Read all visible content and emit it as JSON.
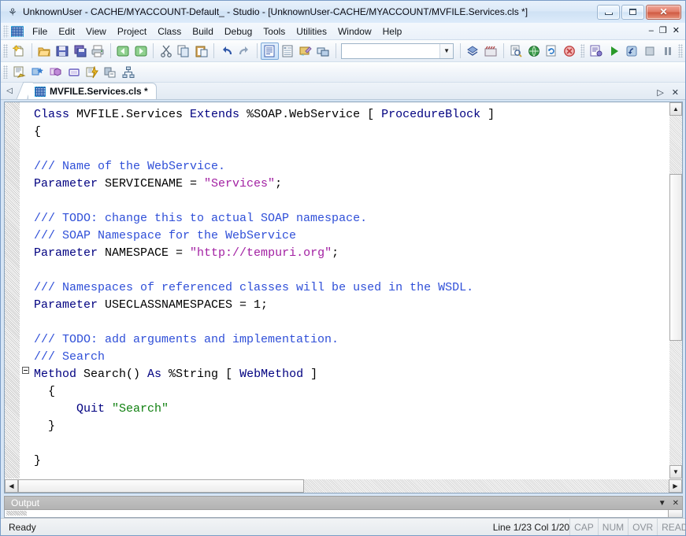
{
  "window": {
    "title": "UnknownUser - CACHE/MYACCOUNT-Default_ - Studio - [UnknownUser-CACHE/MYACCOUNT/MVFILE.Services.cls *]",
    "app_icon": "studio-icon",
    "minimize_label": "Minimize",
    "restore_label": "Restore",
    "close_label": "Close"
  },
  "menubar": {
    "items": [
      {
        "label": "File"
      },
      {
        "label": "Edit"
      },
      {
        "label": "View"
      },
      {
        "label": "Project"
      },
      {
        "label": "Class"
      },
      {
        "label": "Build"
      },
      {
        "label": "Debug"
      },
      {
        "label": "Tools"
      },
      {
        "label": "Utilities"
      },
      {
        "label": "Window"
      },
      {
        "label": "Help"
      }
    ],
    "mdi": {
      "minimize": "–",
      "restore": "❐",
      "close": "✕"
    }
  },
  "toolbar_main": {
    "buttons": [
      {
        "name": "new-file-button",
        "glyph": "✦",
        "color": "#e8a317"
      },
      {
        "name": "open-file-button",
        "glyph": "▱",
        "color": "#e0a030"
      },
      {
        "name": "save-button",
        "glyph": "▣",
        "color": "#4a5fb0"
      },
      {
        "name": "save-all-button",
        "glyph": "▤",
        "color": "#6a5fb0"
      },
      {
        "name": "print-button",
        "glyph": "⎙",
        "color": "#7a8a99"
      },
      {
        "name": "back-button",
        "glyph": "←",
        "color": "#5aa05a"
      },
      {
        "name": "forward-button",
        "glyph": "→",
        "color": "#5aa05a"
      },
      {
        "name": "cut-button",
        "glyph": "✂",
        "color": "#5a6a7a"
      },
      {
        "name": "copy-button",
        "glyph": "⧉",
        "color": "#7a8fa8"
      },
      {
        "name": "paste-button",
        "glyph": "ὌB",
        "color": "#c8a060"
      },
      {
        "name": "undo-button",
        "glyph": "↶",
        "color": "#3a5fb0"
      },
      {
        "name": "redo-button",
        "glyph": "↷",
        "color": "#7a8fa8"
      },
      {
        "name": "view-source-button",
        "glyph": "▤",
        "color": "#3a5fb0",
        "selected": true
      },
      {
        "name": "view-inspector-button",
        "glyph": "☷",
        "color": "#6a7a8a"
      },
      {
        "name": "view-palette-button",
        "glyph": "▧",
        "color": "#c89030"
      },
      {
        "name": "view-layout-button",
        "glyph": "▦",
        "color": "#5a7fb0"
      }
    ],
    "combo": {
      "value": "",
      "placeholder": ""
    },
    "buttons_right": [
      {
        "name": "compile-button",
        "glyph": "◆",
        "color": "#4a6fa5"
      },
      {
        "name": "compile-all-button",
        "glyph": "▥",
        "color": "#a05a5a"
      },
      {
        "name": "find-in-files-button",
        "glyph": "ὐE",
        "color": "#7a8a99"
      },
      {
        "name": "view-web-page-button",
        "glyph": "●",
        "color": "#3a8a3a"
      },
      {
        "name": "refresh-button",
        "glyph": "⟳",
        "color": "#4a7fb0"
      },
      {
        "name": "stop-button",
        "glyph": "✕",
        "color": "#c04040"
      },
      {
        "name": "debug-target-button",
        "glyph": "▤",
        "color": "#6a5fb0"
      },
      {
        "name": "run-button",
        "glyph": "▶",
        "color": "#2a9a2a"
      },
      {
        "name": "step-into-button",
        "glyph": "↰",
        "color": "#5a7fb0"
      },
      {
        "name": "stop-debug-button",
        "glyph": "■",
        "color": "#8090a0"
      },
      {
        "name": "pause-button",
        "glyph": "⏸",
        "color": "#6a7a8a"
      }
    ]
  },
  "toolbar_second": {
    "buttons": [
      {
        "name": "class-wizard-button",
        "glyph": "▤",
        "color": "#c8a030"
      },
      {
        "name": "new-property-button",
        "glyph": "❖",
        "color": "#3a7fd0"
      },
      {
        "name": "new-method-button",
        "glyph": "⬟",
        "color": "#a060c0"
      },
      {
        "name": "new-parameter-button",
        "glyph": "▭",
        "color": "#7a6fc0"
      },
      {
        "name": "new-query-button",
        "glyph": "⚡",
        "color": "#d0a030"
      },
      {
        "name": "new-index-button",
        "glyph": "▨",
        "color": "#8a9aaa"
      },
      {
        "name": "class-hierarchy-button",
        "glyph": "⛓",
        "color": "#5a7a9a"
      }
    ]
  },
  "tabstrip": {
    "nav_left_icon": "triangle-left-icon",
    "tabs": [
      {
        "label": "MVFILE.Services.cls *",
        "icon": "class-file-icon",
        "active": true
      }
    ],
    "nav_right_icon": "triangle-right-icon",
    "close_icon": "✕"
  },
  "editor": {
    "lines": [
      [
        {
          "t": "Class ",
          "c": "kw"
        },
        {
          "t": "MVFILE.Services",
          "c": "id"
        },
        {
          "t": " Extends ",
          "c": "kw"
        },
        {
          "t": "%SOAP.WebService",
          "c": "id"
        },
        {
          "t": " [ ",
          "c": "pln"
        },
        {
          "t": "ProcedureBlock",
          "c": "kw"
        },
        {
          "t": " ]",
          "c": "pln"
        }
      ],
      [
        {
          "t": "{",
          "c": "pln"
        }
      ],
      [
        {
          "t": "",
          "c": "pln"
        }
      ],
      [
        {
          "t": "/// Name of the WebService.",
          "c": "cmt"
        }
      ],
      [
        {
          "t": "Parameter ",
          "c": "kw"
        },
        {
          "t": "SERVICENAME = ",
          "c": "id"
        },
        {
          "t": "\"Services\"",
          "c": "str"
        },
        {
          "t": ";",
          "c": "pln"
        }
      ],
      [
        {
          "t": "",
          "c": "pln"
        }
      ],
      [
        {
          "t": "/// TODO: change this to actual SOAP namespace.",
          "c": "cmt"
        }
      ],
      [
        {
          "t": "/// SOAP Namespace for the WebService",
          "c": "cmt"
        }
      ],
      [
        {
          "t": "Parameter ",
          "c": "kw"
        },
        {
          "t": "NAMESPACE = ",
          "c": "id"
        },
        {
          "t": "\"http://tempuri.org\"",
          "c": "str"
        },
        {
          "t": ";",
          "c": "pln"
        }
      ],
      [
        {
          "t": "",
          "c": "pln"
        }
      ],
      [
        {
          "t": "/// Namespaces of referenced classes will be used in the WSDL.",
          "c": "cmt"
        }
      ],
      [
        {
          "t": "Parameter ",
          "c": "kw"
        },
        {
          "t": "USECLASSNAMESPACES = 1;",
          "c": "id"
        }
      ],
      [
        {
          "t": "",
          "c": "pln"
        }
      ],
      [
        {
          "t": "/// TODO: add arguments and implementation.",
          "c": "cmt"
        }
      ],
      [
        {
          "t": "/// Search",
          "c": "cmt"
        }
      ],
      [
        {
          "t": "Method ",
          "c": "kw"
        },
        {
          "t": "Search() ",
          "c": "id"
        },
        {
          "t": "As ",
          "c": "kw"
        },
        {
          "t": "%String",
          "c": "id"
        },
        {
          "t": " [ ",
          "c": "pln"
        },
        {
          "t": "WebMethod",
          "c": "kw"
        },
        {
          "t": " ]",
          "c": "pln"
        }
      ],
      [
        {
          "t": "  {",
          "c": "pln"
        }
      ],
      [
        {
          "t": "      ",
          "c": "pln"
        },
        {
          "t": "Quit ",
          "c": "kw"
        },
        {
          "t": "\"Search\"",
          "c": "strg"
        }
      ],
      [
        {
          "t": "  }",
          "c": "pln"
        }
      ],
      [
        {
          "t": "",
          "c": "pln"
        }
      ],
      [
        {
          "t": "}",
          "c": "pln"
        }
      ]
    ],
    "fold_marker_line": 16,
    "vscroll": {
      "up_icon": "▲",
      "down_icon": "▼"
    },
    "hscroll": {
      "left_icon": "◀",
      "right_icon": "▶"
    }
  },
  "output_pane": {
    "title": "Output",
    "menu_icon": "▼",
    "close_icon": "✕"
  },
  "statusbar": {
    "status": "Ready",
    "position": "Line 1/23 Col 1/20",
    "flags": [
      "CAP",
      "NUM",
      "OVR",
      "READ"
    ]
  },
  "colors": {
    "titlebar_start": "#e8f1fb",
    "titlebar_end": "#dcebfa",
    "window_bg": "#d6e5f5",
    "keyword": "#000080",
    "comment": "#2f4fd8",
    "string": "#a21fa2",
    "string_green": "#108010",
    "close_button": "#cf5a42"
  }
}
